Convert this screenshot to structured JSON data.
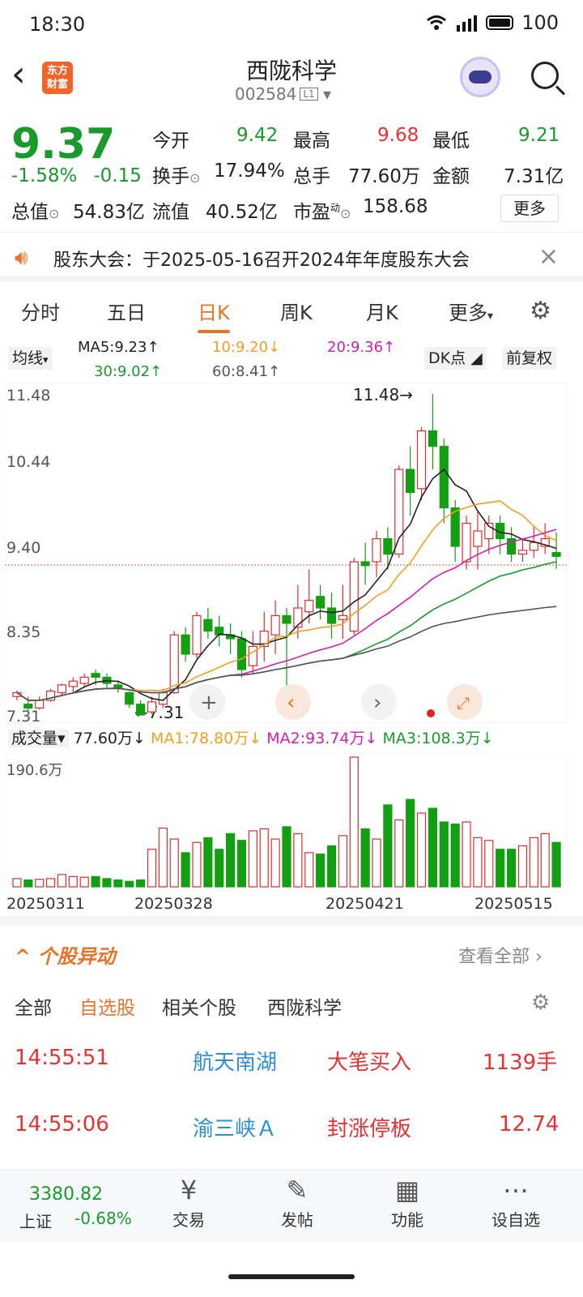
{
  "status": {
    "time": "18:30",
    "battery": "100",
    "signal": "5G"
  },
  "header": {
    "title": "西陇科学",
    "code": "002584",
    "level": "L1",
    "logo": "东方财富"
  },
  "quote": {
    "price": "9.37",
    "change_pct": "-1.58%",
    "change": "-0.15",
    "open_label": "今开",
    "open": "9.42",
    "high_label": "最高",
    "high": "9.68",
    "low_label": "最低",
    "low": "9.21",
    "turnover_label": "换手",
    "turnover": "17.94%",
    "volume_label": "总手",
    "volume": "77.60万",
    "amount_label": "金额",
    "amount": "7.31亿",
    "mktcap_label": "总值",
    "mktcap": "54.83亿",
    "float_label": "流值",
    "float": "40.52亿",
    "pe_label": "市盈",
    "pe_super": "动",
    "pe": "158.68",
    "more": "更多"
  },
  "notice": {
    "text": "股东大会：于2025-05-16召开2024年年度股东大会"
  },
  "tabs": [
    "分时",
    "五日",
    "日K",
    "周K",
    "月K",
    "更多"
  ],
  "active_tab": "日K",
  "ma": {
    "selector": "均线",
    "ma5": "MA5:9.23↑",
    "ma10": "10:9.20↓",
    "ma20": "20:9.36↑",
    "ma30": "30:9.02↑",
    "ma60": "60:8.41↑",
    "dk": "DK点",
    "adjust": "前复权",
    "colors": {
      "ma5": "#222222",
      "ma10": "#f0a020",
      "ma20": "#d020b0",
      "ma30": "#1a9a2d",
      "ma60": "#555555"
    }
  },
  "price_axis": [
    "11.48",
    "10.44",
    "9.40",
    "8.35",
    "7.31"
  ],
  "price_annotations": {
    "high": "11.48→",
    "low": "←7.31"
  },
  "volume": {
    "label": "成交量",
    "value": "77.60万↓",
    "ma1": "MA1:78.80万↓",
    "ma2": "MA2:93.74万↓",
    "ma3": "MA3:108.3万↓",
    "max": "190.6万"
  },
  "dates": [
    "20250311",
    "20250328",
    "20250421",
    "20250515"
  ],
  "movement": {
    "title": "个股异动",
    "view_all": "查看全部",
    "tabs": [
      "全部",
      "自选股",
      "相关个股",
      "西陇科学"
    ],
    "active": "自选股",
    "rows": [
      {
        "time": "14:55:51",
        "name": "航天南湖",
        "event": "大笔买入",
        "value": "1139手"
      },
      {
        "time": "14:55:06",
        "name": "渝三峡Ａ",
        "event": "封涨停板",
        "value": "12.74"
      }
    ]
  },
  "bottom": {
    "index_value": "3380.82",
    "index_name": "上证",
    "index_change": "-0.68%",
    "nav": [
      "交易",
      "发帖",
      "功能",
      "设自选"
    ]
  },
  "chart_data": {
    "type": "candlestick",
    "ylim": [
      7.31,
      11.48
    ],
    "candles": [
      [
        7.55,
        7.6,
        7.5,
        7.63
      ],
      [
        7.45,
        7.4,
        7.35,
        7.55
      ],
      [
        7.4,
        7.5,
        7.38,
        7.55
      ],
      [
        7.5,
        7.62,
        7.48,
        7.65
      ],
      [
        7.6,
        7.7,
        7.55,
        7.72
      ],
      [
        7.68,
        7.75,
        7.6,
        7.8
      ],
      [
        7.72,
        7.8,
        7.68,
        7.85
      ],
      [
        7.85,
        7.8,
        7.7,
        7.9
      ],
      [
        7.8,
        7.72,
        7.65,
        7.85
      ],
      [
        7.7,
        7.66,
        7.6,
        7.76
      ],
      [
        7.6,
        7.45,
        7.4,
        7.62
      ],
      [
        7.45,
        7.31,
        7.31,
        7.5
      ],
      [
        7.35,
        7.48,
        7.32,
        7.55
      ],
      [
        7.45,
        7.6,
        7.4,
        7.65
      ],
      [
        7.6,
        8.35,
        7.58,
        8.4
      ],
      [
        8.35,
        8.1,
        8.0,
        8.45
      ],
      [
        8.1,
        8.6,
        8.05,
        8.65
      ],
      [
        8.55,
        8.4,
        8.3,
        8.7
      ],
      [
        8.45,
        8.35,
        8.2,
        8.6
      ],
      [
        8.35,
        8.3,
        8.1,
        8.5
      ],
      [
        8.3,
        7.9,
        7.8,
        8.4
      ],
      [
        7.95,
        8.2,
        7.85,
        8.4
      ],
      [
        8.2,
        8.4,
        8.0,
        8.65
      ],
      [
        8.35,
        8.6,
        8.1,
        8.8
      ],
      [
        8.6,
        8.5,
        7.4,
        8.7
      ],
      [
        8.45,
        8.7,
        8.3,
        9.0
      ],
      [
        8.65,
        8.8,
        8.5,
        9.2
      ],
      [
        8.85,
        8.7,
        8.55,
        9.0
      ],
      [
        8.7,
        8.5,
        8.3,
        8.9
      ],
      [
        8.55,
        8.6,
        8.3,
        9.0
      ],
      [
        8.4,
        9.3,
        8.35,
        9.35
      ],
      [
        9.3,
        9.25,
        9.0,
        9.55
      ],
      [
        9.3,
        9.6,
        9.1,
        9.7
      ],
      [
        9.6,
        9.4,
        9.2,
        9.75
      ],
      [
        9.4,
        10.5,
        9.35,
        10.55
      ],
      [
        10.5,
        10.2,
        9.9,
        10.8
      ],
      [
        10.25,
        11.0,
        10.1,
        11.05
      ],
      [
        11.0,
        10.8,
        10.5,
        11.48
      ],
      [
        10.8,
        10.0,
        9.8,
        10.9
      ],
      [
        10.0,
        9.5,
        9.3,
        10.1
      ],
      [
        9.3,
        9.8,
        9.2,
        9.9
      ],
      [
        9.5,
        9.7,
        9.2,
        9.95
      ],
      [
        9.6,
        9.8,
        9.4,
        9.9
      ],
      [
        9.8,
        9.6,
        9.4,
        9.9
      ],
      [
        9.6,
        9.4,
        9.3,
        9.75
      ],
      [
        9.4,
        9.45,
        9.3,
        9.6
      ],
      [
        9.45,
        9.55,
        9.35,
        9.75
      ],
      [
        9.5,
        9.6,
        9.4,
        9.8
      ],
      [
        9.42,
        9.37,
        9.21,
        9.68
      ]
    ],
    "volumes": [
      12,
      10,
      11,
      12,
      18,
      15,
      14,
      15,
      12,
      10,
      8,
      10,
      55,
      86,
      70,
      50,
      65,
      72,
      55,
      78,
      68,
      82,
      85,
      70,
      88,
      78,
      50,
      48,
      60,
      75,
      190,
      85,
      70,
      120,
      98,
      128,
      108,
      115,
      95,
      92,
      95,
      72,
      68,
      55,
      55,
      60,
      72,
      78,
      65
    ]
  }
}
